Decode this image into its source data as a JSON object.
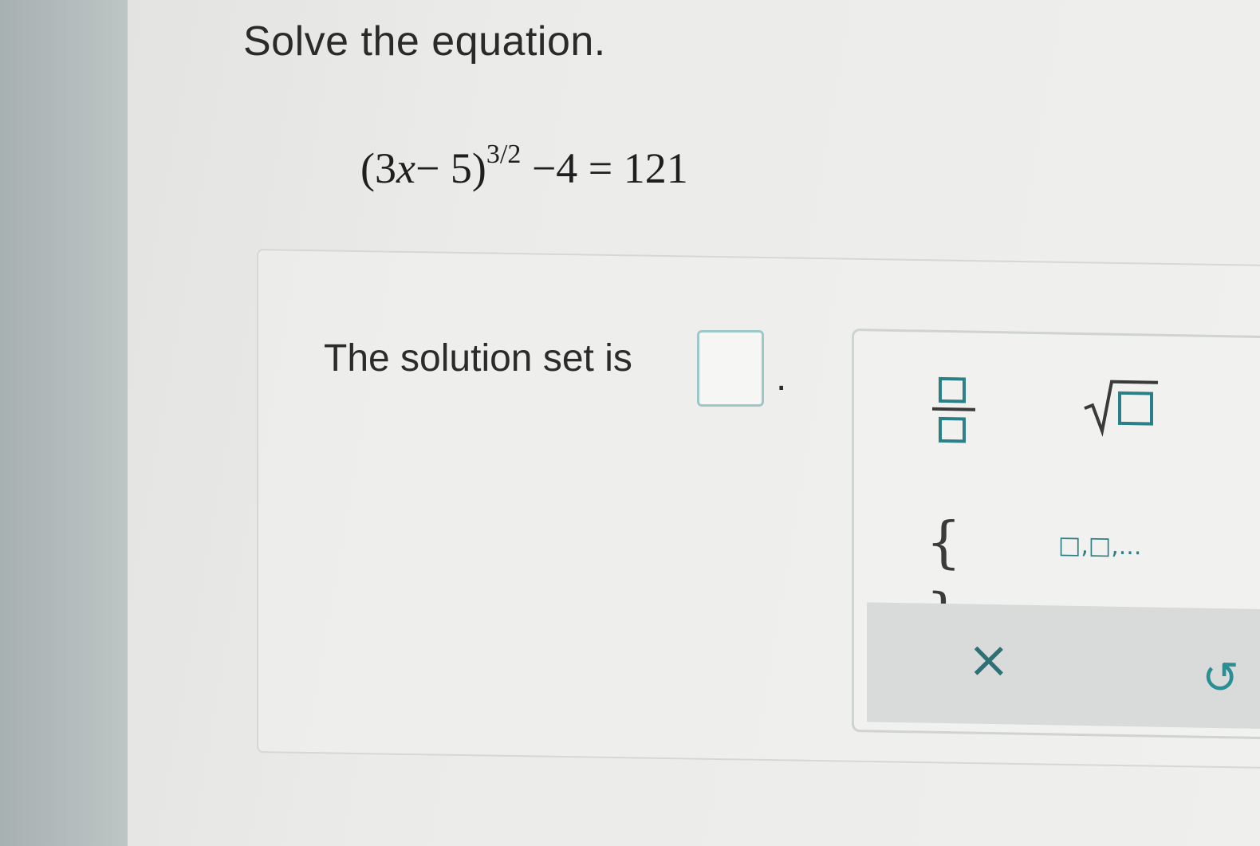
{
  "question": {
    "instruction": "Solve the equation.",
    "equation": {
      "open": "(3",
      "variable": "x",
      "rest": "− 5)",
      "exponent": "3/2",
      "tail": " −4 = 121"
    }
  },
  "answer": {
    "prompt": "The solution set is",
    "input_value": "",
    "period": "."
  },
  "palette": {
    "buttons": [
      {
        "name": "fraction",
        "icon": "fraction-template-icon"
      },
      {
        "name": "square-root",
        "icon": "sqrt-template-icon"
      },
      {
        "name": "set-braces",
        "glyph": "{ }"
      },
      {
        "name": "list",
        "glyph": "□,□,..."
      }
    ],
    "clear_glyph": "×",
    "undo_glyph": "↺"
  },
  "colors": {
    "accent": "#2a8f95",
    "box_border": "#9cc8c9"
  }
}
